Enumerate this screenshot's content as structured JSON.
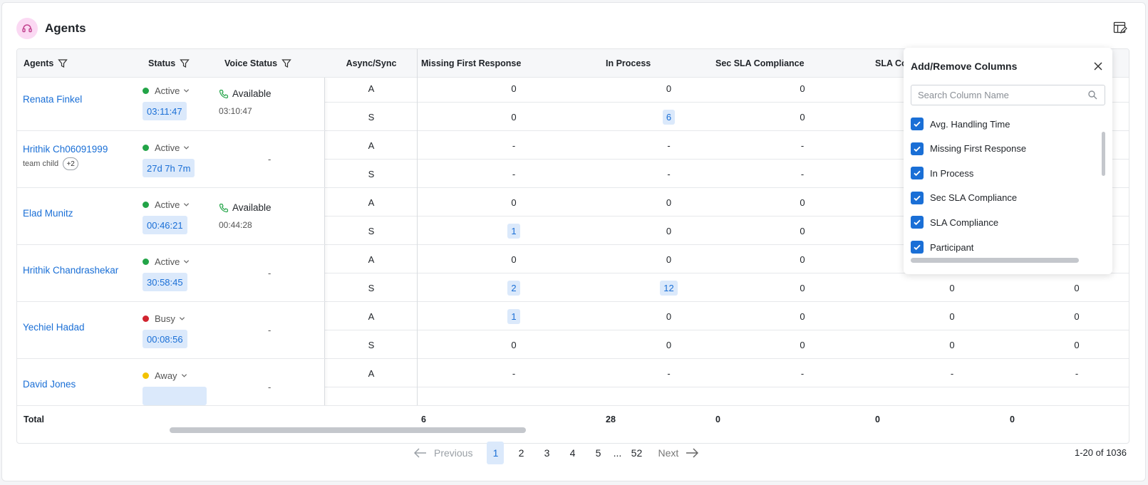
{
  "header": {
    "title": "Agents"
  },
  "columns": {
    "agents": "Agents",
    "status": "Status",
    "voice_status": "Voice Status",
    "async_sync": "Async/Sync",
    "missing_first_response": "Missing First Response",
    "in_process": "In Process",
    "sec_sla": "Sec SLA Compliance",
    "sla": "SLA Co"
  },
  "agents": [
    {
      "name": "Renata Finkel",
      "team": "",
      "more": "",
      "status": "Active",
      "status_color": "#22a447",
      "timer": "03:11:47",
      "voice": "Available",
      "voice_time": "03:10:47"
    },
    {
      "name": "Hrithik Ch06091999",
      "team": "team child",
      "more": "+2",
      "status": "Active",
      "status_color": "#22a447",
      "timer": "27d 7h 7m",
      "voice": "",
      "voice_time": "",
      "voice_dash": "-"
    },
    {
      "name": "Elad Munitz",
      "team": "",
      "more": "",
      "status": "Active",
      "status_color": "#22a447",
      "timer": "00:46:21",
      "voice": "Available",
      "voice_time": "00:44:28"
    },
    {
      "name": "Hrithik Chandrashekar",
      "team": "",
      "more": "",
      "status": "Active",
      "status_color": "#22a447",
      "timer": "30:58:45",
      "voice": "",
      "voice_time": "",
      "voice_dash": "-"
    },
    {
      "name": "Yechiel Hadad",
      "team": "",
      "more": "",
      "status": "Busy",
      "status_color": "#d1242f",
      "timer": "00:08:56",
      "voice": "",
      "voice_time": "",
      "voice_dash": "-"
    },
    {
      "name": "David Jones",
      "team": "",
      "more": "",
      "status": "Away",
      "status_color": "#f2c200",
      "timer": "",
      "voice": "",
      "voice_time": "",
      "voice_dash": "-"
    }
  ],
  "rows": [
    {
      "type": "A",
      "mfr": "0",
      "ip": "0",
      "sec": "0",
      "sla": "",
      "part": ""
    },
    {
      "type": "S",
      "mfr": "0",
      "ip": "6",
      "sec": "0",
      "sla": "",
      "part": ""
    },
    {
      "type": "A",
      "mfr": "-",
      "ip": "-",
      "sec": "-",
      "sla": "",
      "part": ""
    },
    {
      "type": "S",
      "mfr": "-",
      "ip": "-",
      "sec": "-",
      "sla": "",
      "part": ""
    },
    {
      "type": "A",
      "mfr": "0",
      "ip": "0",
      "sec": "0",
      "sla": "",
      "part": ""
    },
    {
      "type": "S",
      "mfr": "1",
      "ip": "0",
      "sec": "0",
      "sla": "",
      "part": ""
    },
    {
      "type": "A",
      "mfr": "0",
      "ip": "0",
      "sec": "0",
      "sla": "",
      "part": ""
    },
    {
      "type": "S",
      "mfr": "2",
      "ip": "12",
      "sec": "0",
      "sla": "0",
      "part": "0"
    },
    {
      "type": "A",
      "mfr": "1",
      "ip": "0",
      "sec": "0",
      "sla": "0",
      "part": "0"
    },
    {
      "type": "S",
      "mfr": "0",
      "ip": "0",
      "sec": "0",
      "sla": "0",
      "part": "0"
    },
    {
      "type": "A",
      "mfr": "-",
      "ip": "-",
      "sec": "-",
      "sla": "-",
      "part": "-"
    }
  ],
  "totals": {
    "label": "Total",
    "mfr": "6",
    "ip": "28",
    "sec": "0",
    "sla": "0",
    "part": "0"
  },
  "pagination": {
    "previous": "Previous",
    "next": "Next",
    "pages": [
      "1",
      "2",
      "3",
      "4",
      "5",
      "...",
      "52"
    ],
    "active": "1",
    "range": "1-20 of 1036"
  },
  "column_picker": {
    "title": "Add/Remove Columns",
    "search_placeholder": "Search Column Name",
    "options": [
      {
        "label": "Avg. Handling Time",
        "checked": true
      },
      {
        "label": "Missing First Response",
        "checked": true
      },
      {
        "label": "In Process",
        "checked": true
      },
      {
        "label": "Sec SLA Compliance",
        "checked": true
      },
      {
        "label": "SLA Compliance",
        "checked": true
      },
      {
        "label": "Participant",
        "checked": true
      }
    ]
  },
  "colors": {
    "accent": "#1a6fd6",
    "accent_bg": "#dbe9fb",
    "active": "#22a447",
    "busy": "#d1242f",
    "away": "#f2c200"
  }
}
